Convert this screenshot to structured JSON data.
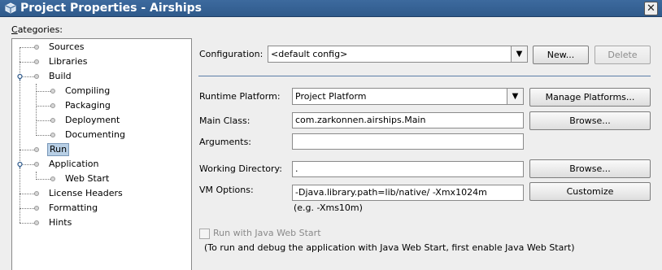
{
  "window": {
    "title": "Project Properties - Airships",
    "close_glyph": "✕"
  },
  "categories": {
    "label": "Categories:",
    "label_mnemonic_index": 0,
    "items": [
      {
        "label": "Sources",
        "level": 0
      },
      {
        "label": "Libraries",
        "level": 0
      },
      {
        "label": "Build",
        "level": 0,
        "expandable": true
      },
      {
        "label": "Compiling",
        "level": 1
      },
      {
        "label": "Packaging",
        "level": 1
      },
      {
        "label": "Deployment",
        "level": 1
      },
      {
        "label": "Documenting",
        "level": 1
      },
      {
        "label": "Run",
        "level": 0,
        "selected": true
      },
      {
        "label": "Application",
        "level": 0,
        "expandable": true
      },
      {
        "label": "Web Start",
        "level": 1
      },
      {
        "label": "License Headers",
        "level": 0
      },
      {
        "label": "Formatting",
        "level": 0
      },
      {
        "label": "Hints",
        "level": 0
      }
    ]
  },
  "config": {
    "label": "Configuration:",
    "value": "<default config>",
    "new_button": "New...",
    "delete_button": "Delete"
  },
  "run": {
    "runtime_platform_label": "Runtime Platform:",
    "runtime_platform_value": "Project Platform",
    "manage_platforms_button": "Manage Platforms...",
    "main_class_label": "Main Class:",
    "main_class_value": "com.zarkonnen.airships.Main",
    "browse_main_button": "Browse...",
    "arguments_label": "Arguments:",
    "arguments_value": "",
    "working_dir_label": "Working Directory:",
    "working_dir_value": ".",
    "browse_dir_button": "Browse...",
    "vm_options_label": "VM Options:",
    "vm_options_value": "-Djava.library.path=lib/native/ -Xmx1024m",
    "customize_button": "Customize",
    "vm_hint": "(e.g. -Xms10m)",
    "webstart_checkbox_label": "Run with Java Web Start",
    "webstart_checked": false,
    "webstart_note": "(To run and debug the application with Java Web Start, first enable Java Web Start)"
  },
  "colors": {
    "titlebar": "#2f5a8b",
    "selection": "#b8cfe5",
    "divider": "#5b7ea8"
  }
}
